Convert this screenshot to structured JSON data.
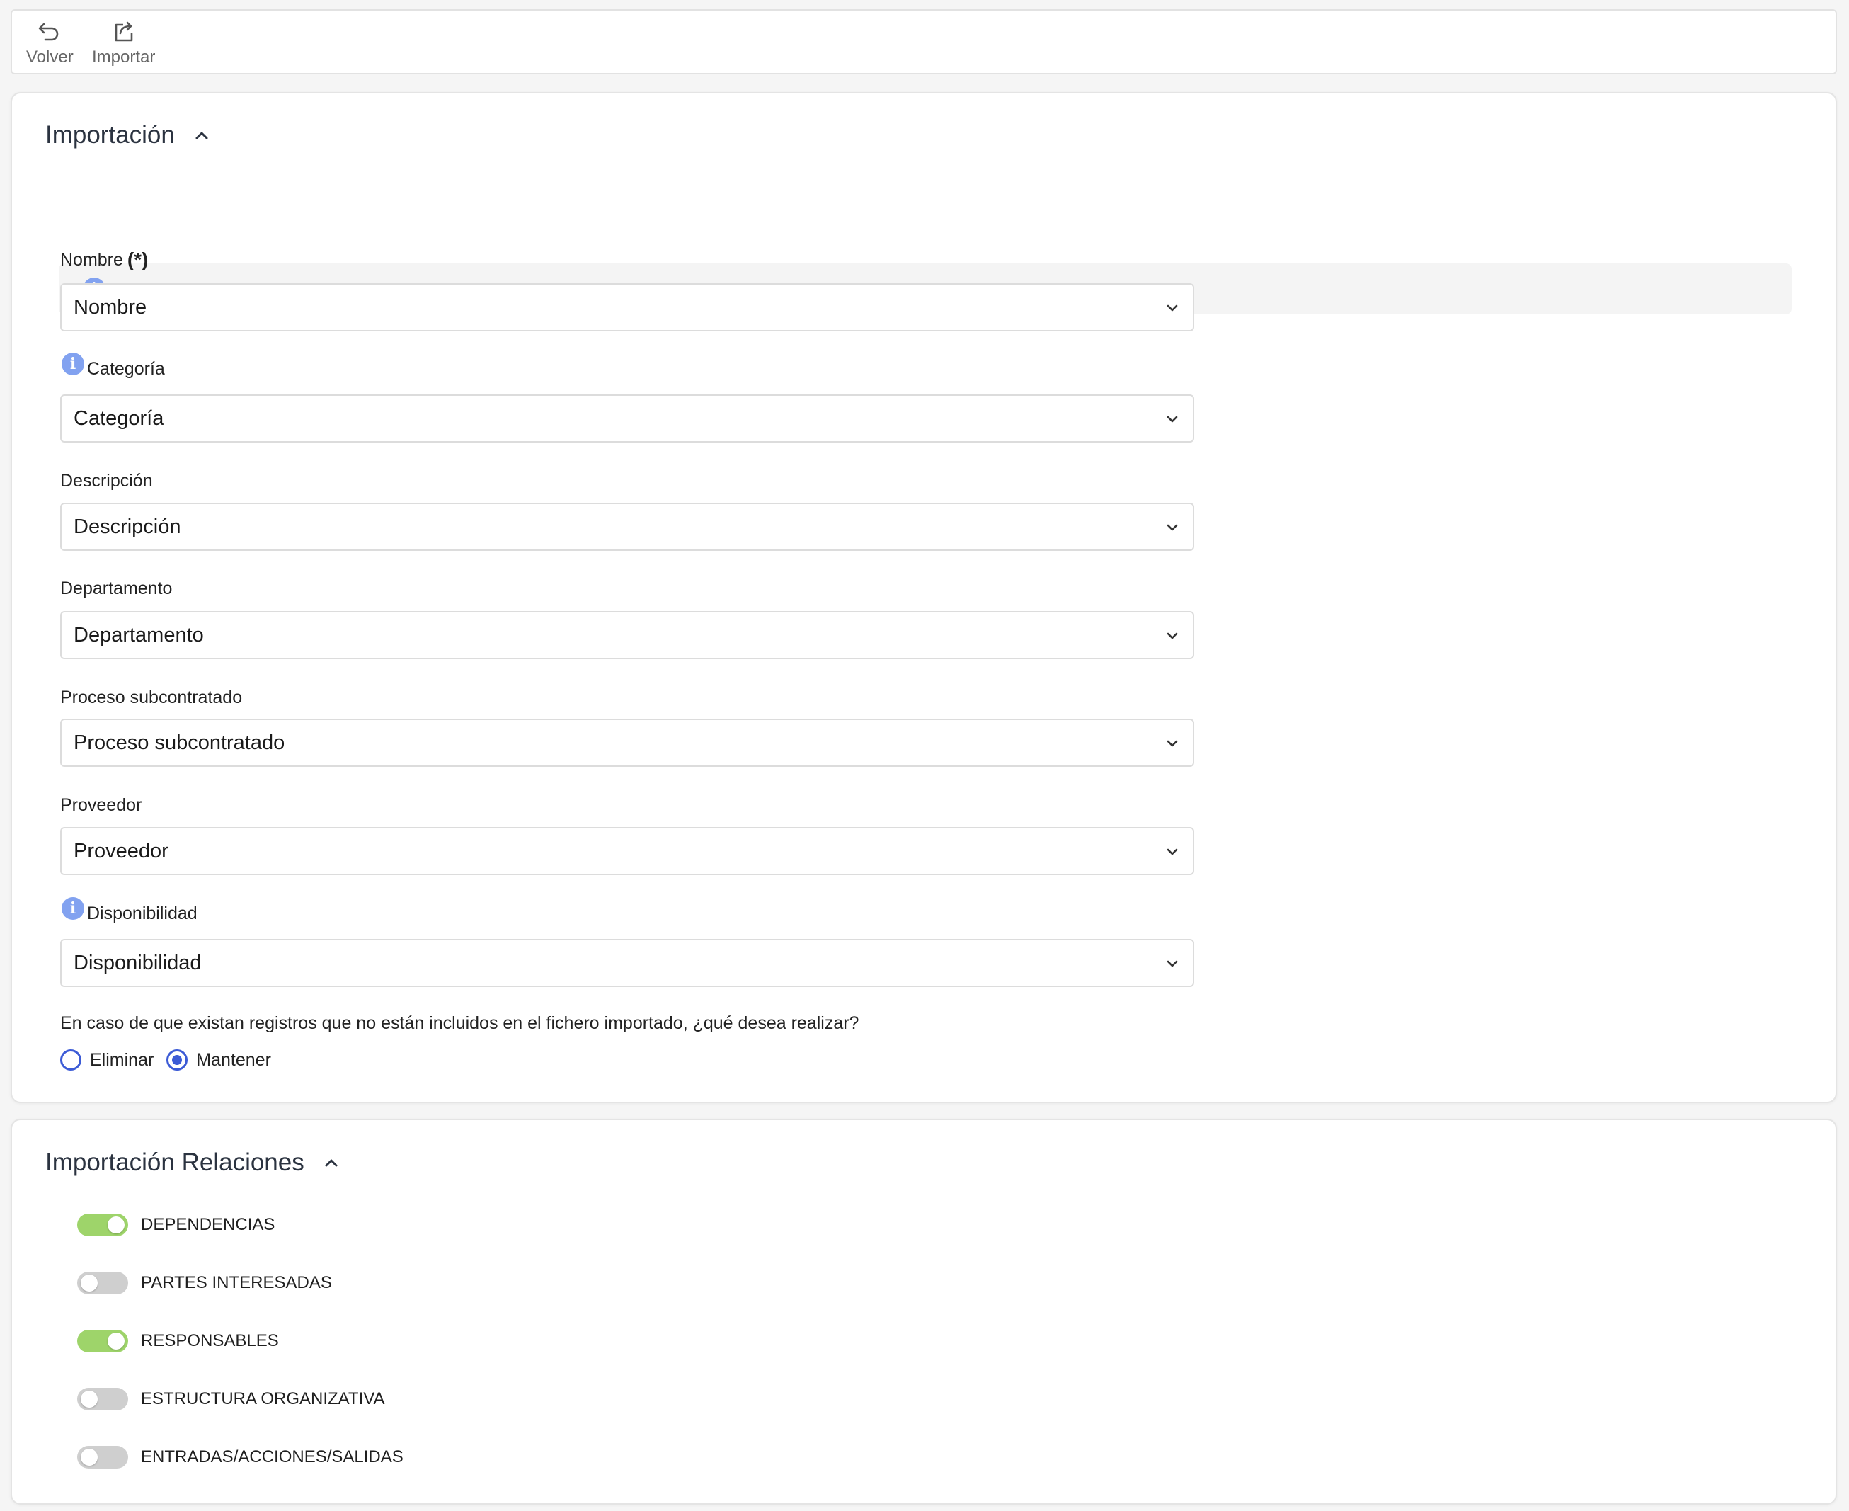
{
  "toolbar": {
    "back_label": "Volver",
    "import_label": "Importar"
  },
  "import_section": {
    "title": "Importación",
    "info_text": "En la parte de la izquierda aparecen los campos de GlobalSUITE y en la parte de la derecha se tienen que seleccionar columnas del excel.",
    "fields": [
      {
        "label": "Nombre",
        "required_mark": "(*)",
        "value": "Nombre"
      },
      {
        "label": "Categoría",
        "value": "Categoría"
      },
      {
        "label": "Descripción",
        "value": "Descripción"
      },
      {
        "label": "Departamento",
        "value": "Departamento"
      },
      {
        "label": "Proceso subcontratado",
        "value": "Proceso subcontratado"
      },
      {
        "label": "Proveedor",
        "value": "Proveedor"
      },
      {
        "label": "Disponibilidad",
        "value": "Disponibilidad"
      }
    ],
    "question": "En caso de que existan registros que no están incluidos en el fichero importado, ¿qué desea realizar?",
    "options": [
      {
        "label": "Eliminar",
        "selected": false
      },
      {
        "label": "Mantener",
        "selected": true
      }
    ]
  },
  "relations_section": {
    "title": "Importación Relaciones",
    "toggles": [
      {
        "label": "DEPENDENCIAS",
        "on": true
      },
      {
        "label": "PARTES INTERESADAS",
        "on": false
      },
      {
        "label": "RESPONSABLES",
        "on": true
      },
      {
        "label": "ESTRUCTURA ORGANIZATIVA",
        "on": false
      },
      {
        "label": "ENTRADAS/ACCIONES/SALIDAS",
        "on": false
      }
    ]
  },
  "colors": {
    "accent": "#3c5bd6",
    "info": "#82a2f0",
    "toggle_on": "#9ed46a",
    "toggle_off": "#cfcfcf"
  }
}
